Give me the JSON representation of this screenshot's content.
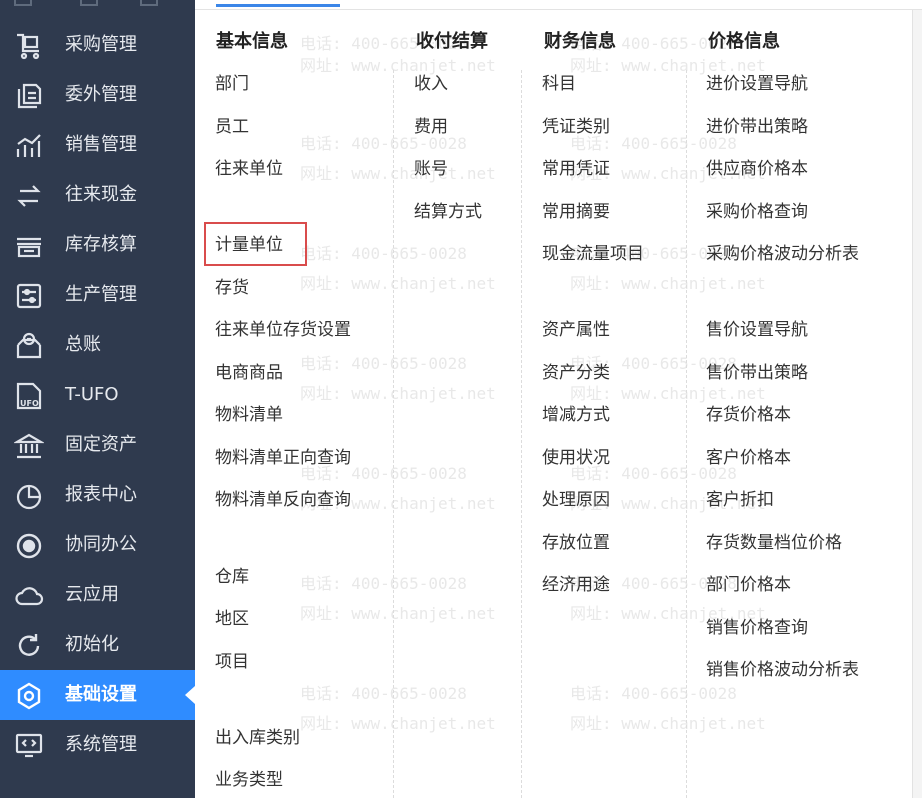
{
  "sidebar": {
    "items": [
      {
        "label": "采购管理",
        "icon": "cart-icon"
      },
      {
        "label": "委外管理",
        "icon": "outsource-icon"
      },
      {
        "label": "销售管理",
        "icon": "sales-chart-icon"
      },
      {
        "label": "往来现金",
        "icon": "exchange-icon"
      },
      {
        "label": "库存核算",
        "icon": "inventory-icon"
      },
      {
        "label": "生产管理",
        "icon": "production-icon"
      },
      {
        "label": "总账",
        "icon": "ledger-icon"
      },
      {
        "label": "T-UFO",
        "icon": "ufo-icon"
      },
      {
        "label": "固定资产",
        "icon": "bank-icon"
      },
      {
        "label": "报表中心",
        "icon": "pie-chart-icon"
      },
      {
        "label": "协同办公",
        "icon": "collab-icon"
      },
      {
        "label": "云应用",
        "icon": "cloud-icon"
      },
      {
        "label": "初始化",
        "icon": "refresh-icon"
      },
      {
        "label": "基础设置",
        "icon": "settings-icon",
        "active": true
      },
      {
        "label": "系统管理",
        "icon": "code-monitor-icon"
      }
    ],
    "active_color": "#2f8cff",
    "bg_color": "#2f3a4e"
  },
  "menu": {
    "columns": [
      {
        "title": "基本信息",
        "items": [
          "部门",
          "员工",
          "往来单位",
          "计量单位",
          "存货",
          "往来单位存货设置",
          "电商商品",
          "物料清单",
          "物料清单正向查询",
          "物料清单反向查询",
          "仓库",
          "地区",
          "项目",
          "出入库类别",
          "业务类型"
        ]
      },
      {
        "title": "收付结算",
        "items": [
          "收入",
          "费用",
          "账号",
          "结算方式"
        ]
      },
      {
        "title": "财务信息",
        "items": [
          "科目",
          "凭证类别",
          "常用凭证",
          "常用摘要",
          "现金流量项目",
          "资产属性",
          "资产分类",
          "增减方式",
          "使用状况",
          "处理原因",
          "存放位置",
          "经济用途"
        ]
      },
      {
        "title": "价格信息",
        "items": [
          "进价设置导航",
          "进价带出策略",
          "供应商价格本",
          "采购价格查询",
          "采购价格波动分析表",
          "售价设置导航",
          "售价带出策略",
          "存货价格本",
          "客户价格本",
          "客户折扣",
          "存货数量档位价格",
          "部门价格本",
          "销售价格查询",
          "销售价格波动分析表"
        ]
      }
    ],
    "highlighted_item": "计量单位",
    "highlight_color": "#d94c4c"
  },
  "watermark": {
    "phone": "电话: 400-665-0028",
    "site": "网址: www.chanjet.net"
  }
}
